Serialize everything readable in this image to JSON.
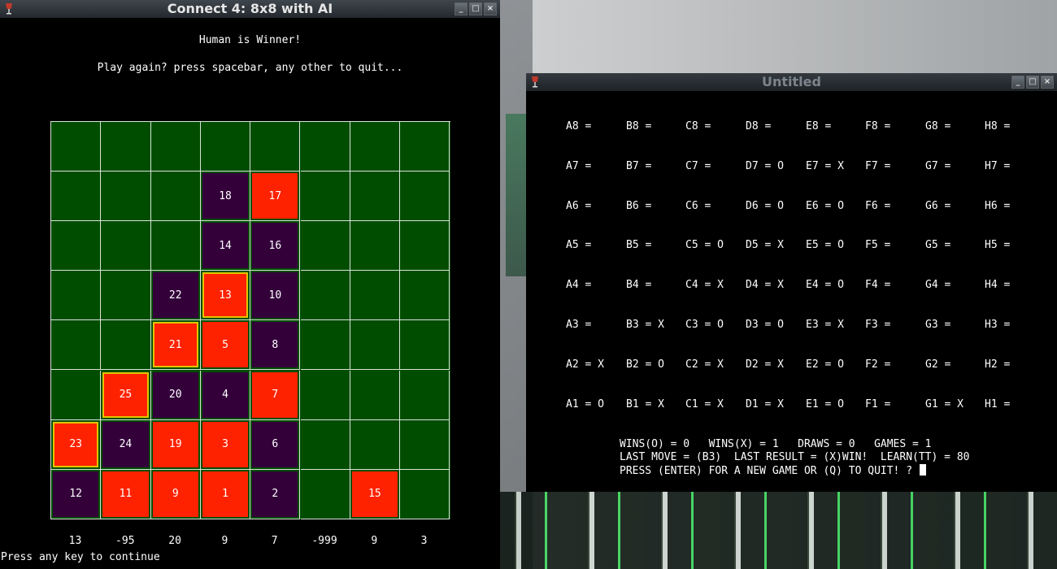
{
  "connect4": {
    "title": "Connect 4: 8x8 with AI",
    "winner_msg": "Human is Winner!",
    "play_again_msg": "Play again? press spacebar, any other to quit...",
    "continue_msg": "Press any key to continue",
    "column_scores": [
      "13",
      "-95",
      "20",
      "9",
      "7",
      "-999",
      "9",
      "3"
    ],
    "colors": {
      "board": "#004d00",
      "red": "#ff2200",
      "purple": "#33003a",
      "highlight": "#e2c400"
    },
    "chips": [
      {
        "col": 3,
        "row": 1,
        "label": "18",
        "color": "purple",
        "hl": false
      },
      {
        "col": 4,
        "row": 1,
        "label": "17",
        "color": "red",
        "hl": false
      },
      {
        "col": 3,
        "row": 2,
        "label": "14",
        "color": "purple",
        "hl": false
      },
      {
        "col": 4,
        "row": 2,
        "label": "16",
        "color": "purple",
        "hl": false
      },
      {
        "col": 2,
        "row": 3,
        "label": "22",
        "color": "purple",
        "hl": false
      },
      {
        "col": 3,
        "row": 3,
        "label": "13",
        "color": "red",
        "hl": true
      },
      {
        "col": 4,
        "row": 3,
        "label": "10",
        "color": "purple",
        "hl": false
      },
      {
        "col": 2,
        "row": 4,
        "label": "21",
        "color": "red",
        "hl": true
      },
      {
        "col": 3,
        "row": 4,
        "label": "5",
        "color": "red",
        "hl": false
      },
      {
        "col": 4,
        "row": 4,
        "label": "8",
        "color": "purple",
        "hl": false
      },
      {
        "col": 1,
        "row": 5,
        "label": "25",
        "color": "red",
        "hl": true
      },
      {
        "col": 2,
        "row": 5,
        "label": "20",
        "color": "purple",
        "hl": false
      },
      {
        "col": 3,
        "row": 5,
        "label": "4",
        "color": "purple",
        "hl": false
      },
      {
        "col": 4,
        "row": 5,
        "label": "7",
        "color": "red",
        "hl": false
      },
      {
        "col": 0,
        "row": 6,
        "label": "23",
        "color": "red",
        "hl": true
      },
      {
        "col": 1,
        "row": 6,
        "label": "24",
        "color": "purple",
        "hl": false
      },
      {
        "col": 2,
        "row": 6,
        "label": "19",
        "color": "red",
        "hl": false
      },
      {
        "col": 3,
        "row": 6,
        "label": "3",
        "color": "red",
        "hl": false
      },
      {
        "col": 4,
        "row": 6,
        "label": "6",
        "color": "purple",
        "hl": false
      },
      {
        "col": 0,
        "row": 7,
        "label": "12",
        "color": "purple",
        "hl": false
      },
      {
        "col": 1,
        "row": 7,
        "label": "11",
        "color": "red",
        "hl": false
      },
      {
        "col": 2,
        "row": 7,
        "label": "9",
        "color": "red",
        "hl": false
      },
      {
        "col": 3,
        "row": 7,
        "label": "1",
        "color": "red",
        "hl": false
      },
      {
        "col": 4,
        "row": 7,
        "label": "2",
        "color": "purple",
        "hl": false
      },
      {
        "col": 6,
        "row": 7,
        "label": "15",
        "color": "red",
        "hl": false
      }
    ]
  },
  "untitled": {
    "title": "Untitled",
    "grid": [
      [
        "A8 =",
        "B8 =",
        "C8 =",
        "D8 =",
        "E8 =",
        "F8 =",
        "G8 =",
        "H8 ="
      ],
      [
        "A7 =",
        "B7 =",
        "C7 =",
        "D7 = O",
        "E7 = X",
        "F7 =",
        "G7 =",
        "H7 ="
      ],
      [
        "A6 =",
        "B6 =",
        "C6 =",
        "D6 = O",
        "E6 = O",
        "F6 =",
        "G6 =",
        "H6 ="
      ],
      [
        "A5 =",
        "B5 =",
        "C5 = O",
        "D5 = X",
        "E5 = O",
        "F5 =",
        "G5 =",
        "H5 ="
      ],
      [
        "A4 =",
        "B4 =",
        "C4 = X",
        "D4 = X",
        "E4 = O",
        "F4 =",
        "G4 =",
        "H4 ="
      ],
      [
        "A3 =",
        "B3 = X",
        "C3 = O",
        "D3 = O",
        "E3 = X",
        "F3 =",
        "G3 =",
        "H3 ="
      ],
      [
        "A2 = X",
        "B2 = O",
        "C2 = X",
        "D2 = X",
        "E2 = O",
        "F2 =",
        "G2 =",
        "H2 ="
      ],
      [
        "A1 = O",
        "B1 = X",
        "C1 = X",
        "D1 = X",
        "E1 = O",
        "F1 =",
        "G1 = X",
        "H1 ="
      ]
    ],
    "status_line1": "WINS(O) = 0   WINS(X) = 1   DRAWS = 0   GAMES = 1",
    "status_line2": "LAST MOVE = (B3)  LAST RESULT = (X)WIN!  LEARN(TT) = 80",
    "status_line3": "PRESS (ENTER) FOR A NEW GAME OR (Q) TO QUIT! ? "
  },
  "window_controls": {
    "minimize": "_",
    "maximize": "□",
    "close": "×"
  }
}
